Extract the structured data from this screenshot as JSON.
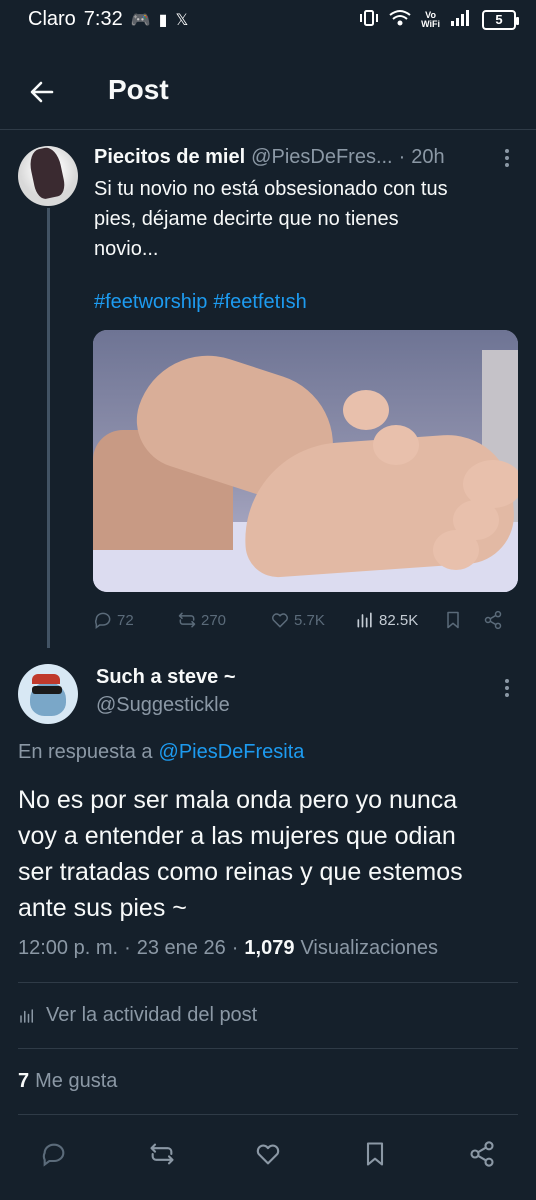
{
  "status_bar": {
    "carrier": "Claro",
    "time": "7:32",
    "wifi_label_top": "Vo",
    "wifi_label_bottom": "WiFi",
    "battery": "5"
  },
  "header": {
    "title": "Post"
  },
  "quoted_post": {
    "name": "Piecitos de miel",
    "handle": "@PiesDeFres...",
    "separator": "·",
    "time": "20h",
    "text": "Si tu novio no está obsesionado con tus\npies, déjame decirte que no tienes\nnovio...",
    "hashtags": [
      "#feetworship",
      "#feetfetısh"
    ],
    "stats": {
      "replies": "72",
      "reposts": "270",
      "likes": "5.7K",
      "views": "82.5K"
    }
  },
  "reply": {
    "name": "Such a steve ~",
    "handle": "@Suggestickle",
    "in_reply_prefix": "En respuesta a",
    "in_reply_mention": "@PiesDeFresita",
    "text": "No es por ser mala onda pero yo nunca\nvoy a entender a las mujeres que odian\nser tratadas como reinas y que estemos\nante sus pies ~",
    "time": "12:00 p. m.",
    "dot1": "·",
    "date": "23 ene 26",
    "dot2": "·",
    "views_count": "1,079",
    "views_label": "Visualizaciones",
    "activity_label": "Ver la actividad del post",
    "likes_count": "7",
    "likes_label": "Me gusta"
  },
  "colors": {
    "background": "#15202b",
    "accent": "#1d9bf0",
    "secondary_text": "#8b98a5"
  }
}
